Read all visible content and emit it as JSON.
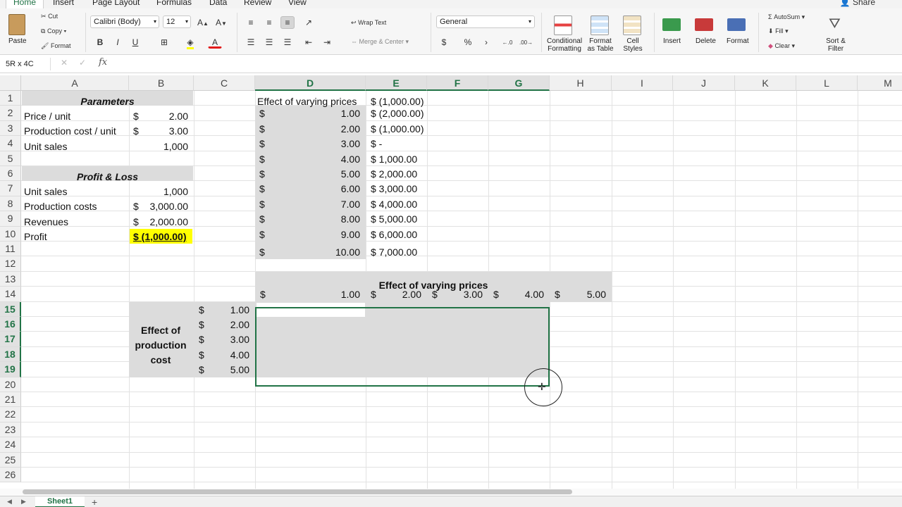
{
  "ribbon_tabs": [
    "Home",
    "Insert",
    "Page Layout",
    "Formulas",
    "Data",
    "Review",
    "View"
  ],
  "share_label": "Share",
  "ribbon": {
    "paste": "Paste",
    "cut": "Cut",
    "copy": "Copy",
    "format_painter": "Format",
    "font_name": "Calibri (Body)",
    "font_size": "12",
    "bold": "B",
    "italic": "I",
    "underline": "U",
    "wrap_text": "Wrap Text",
    "merge_center": "Merge & Center",
    "number_format": "General",
    "currency": "$",
    "percent": "%",
    "conditional_formatting": "Conditional Formatting",
    "format_as_table": "Format as Table",
    "cell_styles": "Cell Styles",
    "insert": "Insert",
    "delete": "Delete",
    "format": "Format",
    "autosum": "AutoSum",
    "fill": "Fill",
    "clear": "Clear",
    "sort_filter": "Sort & Filter"
  },
  "formula_bar": {
    "name_box": "5R x 4C",
    "fx": "fx",
    "formula": ""
  },
  "columns": [
    "A",
    "B",
    "C",
    "D",
    "E",
    "F",
    "G",
    "H",
    "I",
    "J",
    "K",
    "L",
    "M"
  ],
  "selected_columns": [
    "D",
    "E",
    "F",
    "G"
  ],
  "rows": [
    "1",
    "2",
    "3",
    "4",
    "5",
    "6",
    "7",
    "8",
    "9",
    "10",
    "11",
    "12",
    "13",
    "14",
    "15",
    "16",
    "17",
    "18",
    "19",
    "20",
    "21",
    "22",
    "23",
    "24",
    "25",
    "26"
  ],
  "selected_rows": [
    "15",
    "16",
    "17",
    "18",
    "19"
  ],
  "cells": {
    "params_header": "Parameters",
    "a2": "Price / unit",
    "b2_sym": "$",
    "b2": "2.00",
    "a3": "Production cost / unit",
    "b3_sym": "$",
    "b3": "3.00",
    "a4": "Unit sales",
    "b4": "1,000",
    "pl_header": "Profit & Loss",
    "a7": "Unit sales",
    "b7": "1,000",
    "a8": "Production costs",
    "b8_sym": "$",
    "b8": "3,000.00",
    "a9": "Revenues",
    "b9_sym": "$",
    "b9": "2,000.00",
    "a10": "Profit",
    "b10": "$ (1,000.00)",
    "d1": "Effect of varying prices",
    "e1": "$ (1,000.00)",
    "d_sym": "$",
    "d_prices": [
      "1.00",
      "2.00",
      "3.00",
      "4.00",
      "5.00",
      "6.00",
      "7.00",
      "8.00",
      "9.00",
      "10.00"
    ],
    "e_profits": [
      "$ (2,000.00)",
      "$ (1,000.00)",
      "$          -",
      "$  1,000.00",
      "$  2,000.00",
      "$  3,000.00",
      "$  4,000.00",
      "$  5,000.00",
      "$  6,000.00",
      "$  7,000.00"
    ],
    "table2_title": "Effect of varying prices",
    "row14_prices": [
      "1.00",
      "2.00",
      "3.00",
      "4.00",
      "5.00"
    ],
    "c_costs": [
      "1.00",
      "2.00",
      "3.00",
      "4.00",
      "5.00"
    ],
    "b_label_lines": [
      "Effect of",
      "production",
      "cost"
    ]
  },
  "sheet_tab": "Sheet1",
  "add_sheet": "+"
}
